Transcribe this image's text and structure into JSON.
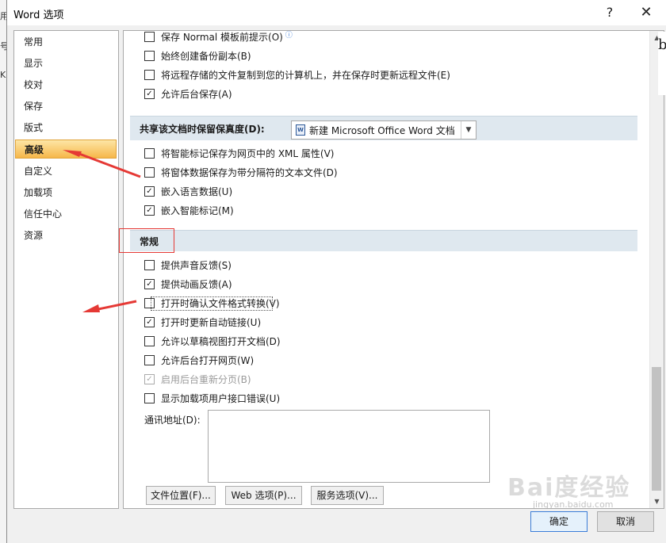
{
  "window": {
    "title": "Word 选项",
    "help_label": "?",
    "close_label": "✕"
  },
  "background_edge": {
    "left_glyphs": [
      "用",
      "号",
      "K"
    ],
    "right_glyph": "b"
  },
  "nav": {
    "items": [
      {
        "label": "常用",
        "selected": false
      },
      {
        "label": "显示",
        "selected": false
      },
      {
        "label": "校对",
        "selected": false
      },
      {
        "label": "保存",
        "selected": false
      },
      {
        "label": "版式",
        "selected": false
      },
      {
        "label": "高级",
        "selected": true
      },
      {
        "label": "自定义",
        "selected": false
      },
      {
        "label": "加载项",
        "selected": false
      },
      {
        "label": "信任中心",
        "selected": false
      },
      {
        "label": "资源",
        "selected": false
      }
    ]
  },
  "save_options": [
    {
      "label": "保存 Normal 模板前提示(O)",
      "checked": false,
      "info_icon": true
    },
    {
      "label": "始终创建备份副本(B)",
      "checked": false
    },
    {
      "label": "将远程存储的文件复制到您的计算机上，并在保存时更新远程文件(E)",
      "checked": false
    },
    {
      "label": "允许后台保存(A)",
      "checked": true
    }
  ],
  "share_section": {
    "label": "共享该文档时保留保真度(D):",
    "selected_doc": "新建 Microsoft Office Word 文档",
    "options": [
      {
        "label": "将智能标记保存为网页中的 XML 属性(V)",
        "checked": false
      },
      {
        "label": "将窗体数据保存为带分隔符的文本文件(D)",
        "checked": false
      },
      {
        "label": "嵌入语言数据(U)",
        "checked": true
      },
      {
        "label": "嵌入智能标记(M)",
        "checked": true
      }
    ]
  },
  "general_section": {
    "label": "常规",
    "options": [
      {
        "label": "提供声音反馈(S)",
        "checked": false,
        "disabled": false
      },
      {
        "label": "提供动画反馈(A)",
        "checked": true,
        "disabled": false
      },
      {
        "label": "打开时确认文件格式转换(V)",
        "checked": false,
        "disabled": false
      },
      {
        "label": "打开时更新自动链接(U)",
        "checked": true,
        "disabled": false
      },
      {
        "label": "允许以草稿视图打开文档(D)",
        "checked": false,
        "disabled": false
      },
      {
        "label": "允许后台打开网页(W)",
        "checked": false,
        "disabled": false
      },
      {
        "label": "启用后台重新分页(B)",
        "checked": true,
        "disabled": true
      },
      {
        "label": "显示加载项用户接口错误(U)",
        "checked": false,
        "disabled": false
      }
    ],
    "mail_label": "通讯地址(D):",
    "mail_value": ""
  },
  "bottom_buttons": {
    "file_locations": "文件位置(F)...",
    "web_options": "Web 选项(P)...",
    "service_options": "服务选项(V)..."
  },
  "dialog_buttons": {
    "ok": "确定",
    "cancel": "取消"
  },
  "watermark": {
    "main": "Bai度经验",
    "sub": "jingyan.baidu.com"
  },
  "colors": {
    "selected_nav": "#f6b74a",
    "section_header": "#dfe8ef",
    "annotation": "#e53935"
  }
}
